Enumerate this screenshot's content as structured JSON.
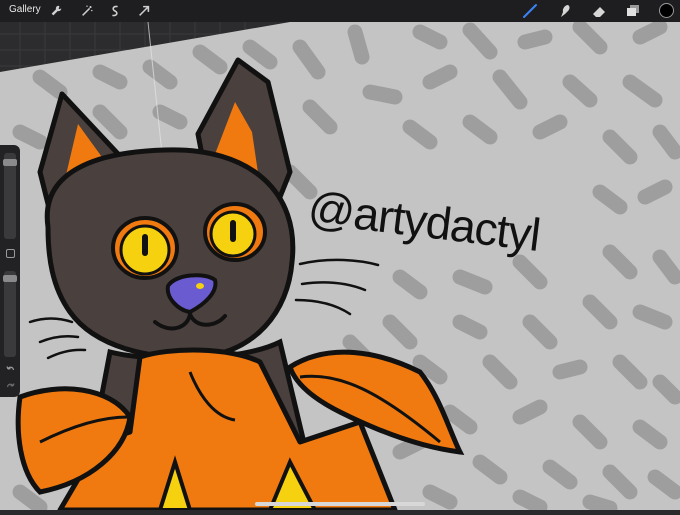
{
  "topbar": {
    "gallery_label": "Gallery",
    "left_tools": [
      "wrench-icon",
      "magic-wand-icon",
      "selection-icon",
      "transform-arrow-icon"
    ],
    "right_tools": [
      "brush-icon",
      "smudge-icon",
      "eraser-icon",
      "layers-icon"
    ],
    "active_tool": "brush-icon",
    "active_tool_color": "#3b82f6",
    "current_color": "#000000"
  },
  "sidebar": {
    "brush_size_level": 0.92,
    "opacity_level": 0.95,
    "modify_button": "square-icon",
    "undo_button": "undo-icon",
    "redo_button": "redo-icon"
  },
  "artwork": {
    "signature": "@artydactyl",
    "background_color": "#c4c4c4",
    "dash_color": "#9e9e9e",
    "cat_fur_color": "#4a403d",
    "eye_color": "#f5d10f",
    "nose_color": "#6a5bd0",
    "leaf_color": "#f07a10"
  }
}
